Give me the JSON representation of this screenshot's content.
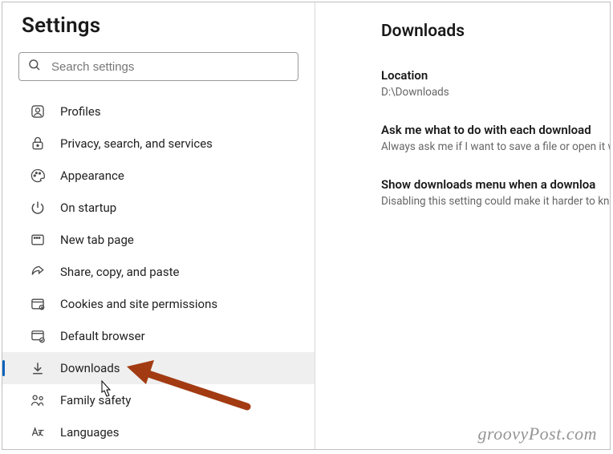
{
  "sidebar": {
    "title": "Settings",
    "search_placeholder": "Search settings",
    "items": [
      {
        "label": "Profiles"
      },
      {
        "label": "Privacy, search, and services"
      },
      {
        "label": "Appearance"
      },
      {
        "label": "On startup"
      },
      {
        "label": "New tab page"
      },
      {
        "label": "Share, copy, and paste"
      },
      {
        "label": "Cookies and site permissions"
      },
      {
        "label": "Default browser"
      },
      {
        "label": "Downloads"
      },
      {
        "label": "Family safety"
      },
      {
        "label": "Languages"
      }
    ]
  },
  "main": {
    "heading": "Downloads",
    "settings": [
      {
        "title": "Location",
        "desc": "D:\\Downloads"
      },
      {
        "title": "Ask me what to do with each download",
        "desc": "Always ask me if I want to save a file or open it w"
      },
      {
        "title": "Show downloads menu when a downloa",
        "desc": "Disabling this setting could make it harder to kno"
      }
    ]
  },
  "watermark": "groovyPost.com",
  "accent_color": "#a33b12"
}
